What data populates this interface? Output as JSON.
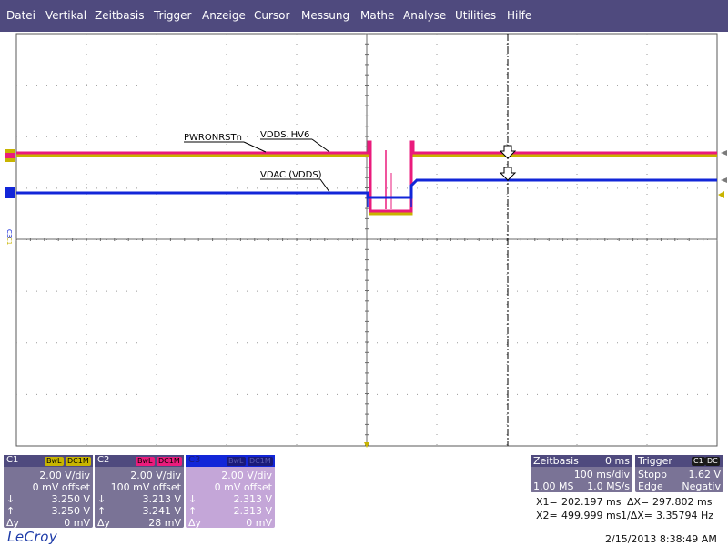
{
  "menu": [
    "Datei",
    "Vertikal",
    "Zeitbasis",
    "Trigger",
    "Anzeige",
    "Cursor",
    "Messung",
    "Mathe",
    "Analyse",
    "Utilities",
    "Hilfe"
  ],
  "colors": {
    "menubar": "#4f4a7e",
    "c1": "#c8b400",
    "c2": "#ea1b7c",
    "c3": "#1226d8",
    "c1_panel": "#7a7396",
    "c2_panel": "#7a7396",
    "c3_panel": "#c4a6d8"
  },
  "annotations": {
    "pwronrstn": "PWRONRSTn",
    "vdds_hv6": "VDDS_HV6",
    "vdac": "VDAC (VDDS)"
  },
  "channel_markers": {
    "c3": "C3",
    "c1": "C1"
  },
  "channels": [
    {
      "id": "C1",
      "bwl": "BwL",
      "coupling": "DC1M",
      "vdiv": "2.00 V/div",
      "offset": "0 mV offset",
      "down": "3.250 V",
      "up": "3.250 V",
      "dy_label": "Δy",
      "dy": "0 mV"
    },
    {
      "id": "C2",
      "bwl": "BwL",
      "coupling": "DC1M",
      "vdiv": "2.00 V/div",
      "offset": "100 mV offset",
      "down": "3.213 V",
      "up": "3.241 V",
      "dy_label": "Δy",
      "dy": "28 mV"
    },
    {
      "id": "C3",
      "bwl": "BwL",
      "coupling": "DC1M",
      "vdiv": "2.00 V/div",
      "offset": "0 mV offset",
      "down": "2.313 V",
      "up": "2.313 V",
      "dy_label": "Δy",
      "dy": "0 mV"
    }
  ],
  "timebase": {
    "label": "Zeitbasis",
    "delay": "0 ms",
    "tdiv": "100 ms/div",
    "samples": "1.00 MS",
    "rate": "1.0 MS/s"
  },
  "trigger": {
    "label": "Trigger",
    "ch_tag1": "C1",
    "ch_tag2": "DC",
    "mode": "Stopp",
    "level": "1.62 V",
    "type": "Edge",
    "slope": "Negativ"
  },
  "cursors": {
    "x1_label": "X1=",
    "x1": "202.197 ms",
    "dx_label": "ΔX=",
    "dx": "297.802 ms",
    "x2_label": "X2=",
    "x2": "499.999 ms",
    "inv_label": "1/ΔX=",
    "inv": "3.35794 Hz"
  },
  "brand": "LeCroy",
  "timestamp": "2/15/2013 8:38:49 AM"
}
